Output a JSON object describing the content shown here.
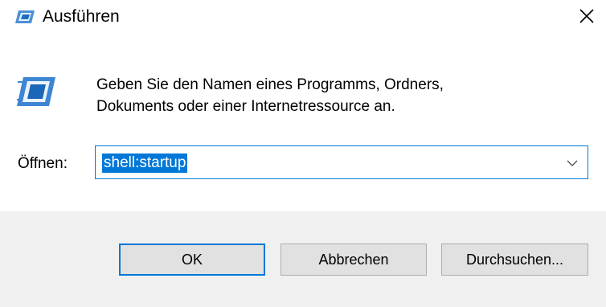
{
  "window": {
    "title": "Ausführen",
    "icon": "run-icon",
    "close_icon": "close-icon"
  },
  "dialog": {
    "description_line1": "Geben Sie den Namen eines Programms, Ordners,",
    "description_line2": "Dokuments oder einer Internetressource an.",
    "open_label": "Öffnen:",
    "input_value": "shell:startup",
    "dropdown_icon": "chevron-down-icon"
  },
  "buttons": {
    "ok": "OK",
    "cancel": "Abbrechen",
    "browse": "Durchsuchen..."
  },
  "colors": {
    "accent": "#0078d7",
    "footer_bg": "#f0f0f0",
    "button_bg": "#e1e1e1"
  }
}
